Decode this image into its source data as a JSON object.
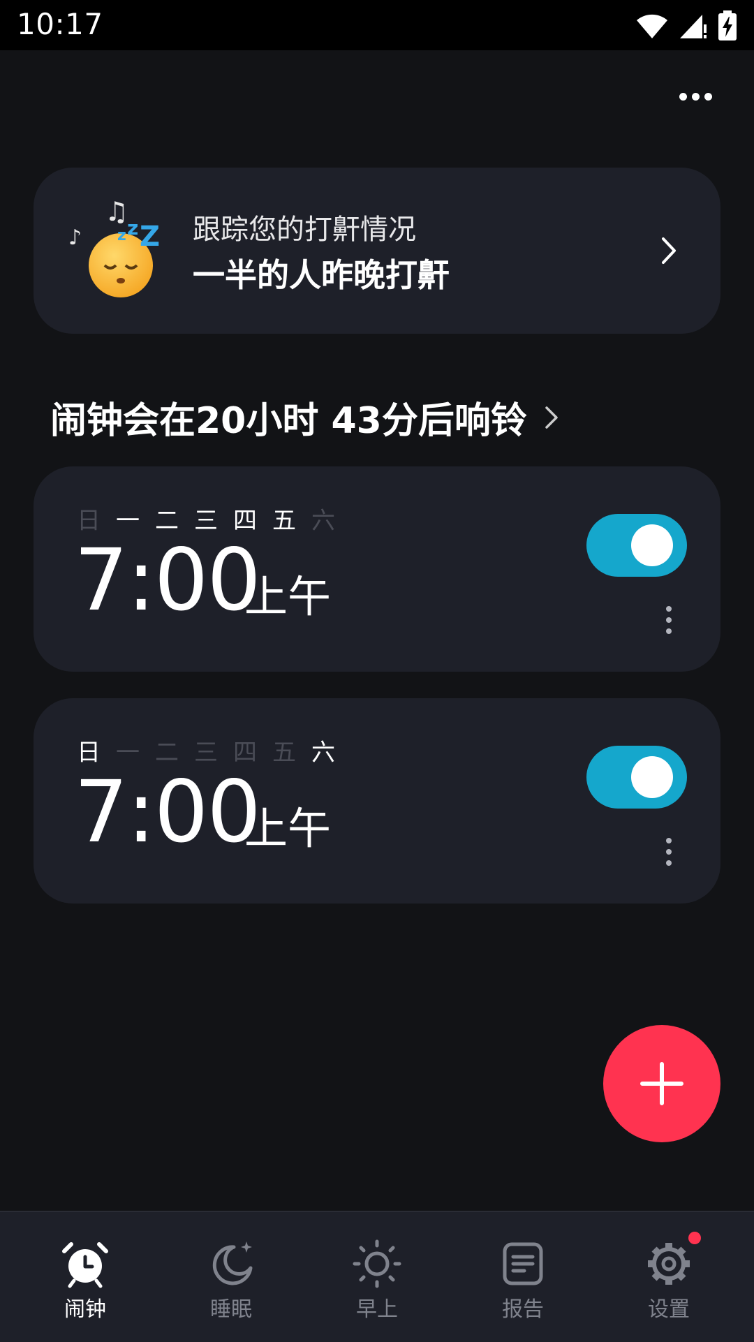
{
  "status_bar": {
    "time": "10:17"
  },
  "snore_card": {
    "line1": "跟踪您的打鼾情况",
    "line2": "一半的人昨晚打鼾"
  },
  "next_alarm": {
    "text": "闹钟会在20小时 43分后响铃"
  },
  "alarms": [
    {
      "days": [
        {
          "label": "日",
          "active": false
        },
        {
          "label": "一",
          "active": true
        },
        {
          "label": "二",
          "active": true
        },
        {
          "label": "三",
          "active": true
        },
        {
          "label": "四",
          "active": true
        },
        {
          "label": "五",
          "active": true
        },
        {
          "label": "六",
          "active": false
        }
      ],
      "time": "7:00",
      "ampm": "上午",
      "enabled": true
    },
    {
      "days": [
        {
          "label": "日",
          "active": true
        },
        {
          "label": "一",
          "active": false
        },
        {
          "label": "二",
          "active": false
        },
        {
          "label": "三",
          "active": false
        },
        {
          "label": "四",
          "active": false
        },
        {
          "label": "五",
          "active": false
        },
        {
          "label": "六",
          "active": true
        }
      ],
      "time": "7:00",
      "ampm": "上午",
      "enabled": true
    }
  ],
  "nav": {
    "items": [
      {
        "label": "闹钟",
        "icon": "alarm-clock-icon",
        "active": true
      },
      {
        "label": "睡眠",
        "icon": "moon-icon",
        "active": false
      },
      {
        "label": "早上",
        "icon": "sun-icon",
        "active": false
      },
      {
        "label": "报告",
        "icon": "report-icon",
        "active": false
      },
      {
        "label": "设置",
        "icon": "gear-icon",
        "active": false,
        "badge": true
      }
    ]
  },
  "colors": {
    "accent": "#15a7cc",
    "fab": "#ff3350",
    "card": "#1e2029",
    "background": "#121316"
  }
}
